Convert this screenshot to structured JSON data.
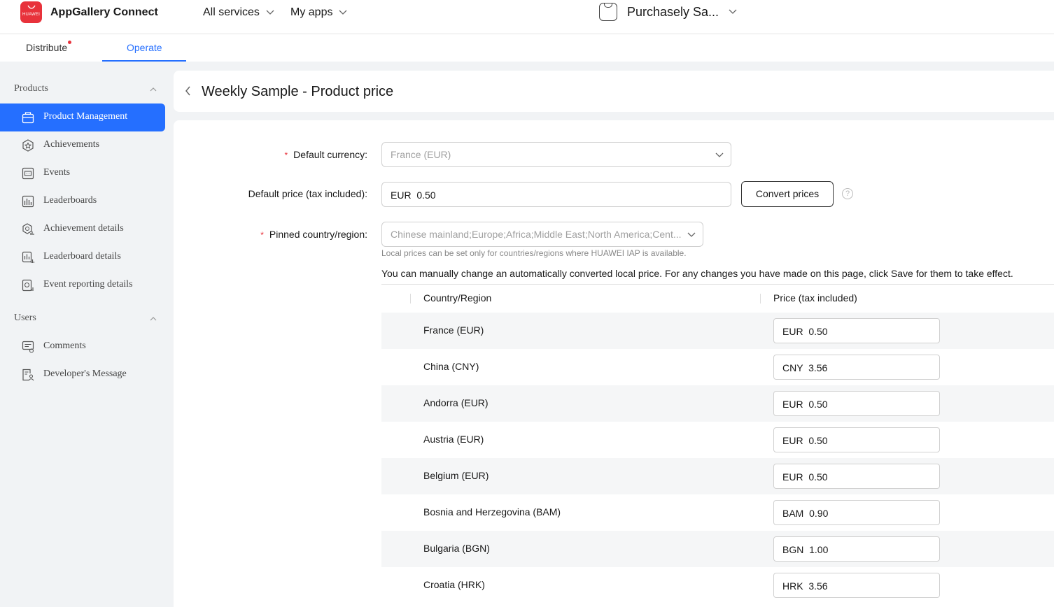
{
  "header": {
    "logo_text": "HUAWEI",
    "app_title": "AppGallery Connect",
    "all_services": "All services",
    "my_apps": "My apps",
    "current_app": "Purchasely Sa..."
  },
  "tabs": {
    "distribute": "Distribute",
    "operate": "Operate"
  },
  "sidebar": {
    "groups": [
      {
        "label": "Products"
      },
      {
        "label": "Users"
      }
    ],
    "items": [
      {
        "label": "Product Management",
        "icon": "bag-icon",
        "active": true
      },
      {
        "label": "Achievements",
        "icon": "achievement-icon"
      },
      {
        "label": "Events",
        "icon": "events-icon"
      },
      {
        "label": "Leaderboards",
        "icon": "leaderboard-icon"
      },
      {
        "label": "Achievement details",
        "icon": "achievement-details-icon"
      },
      {
        "label": "Leaderboard details",
        "icon": "leaderboard-details-icon"
      },
      {
        "label": "Event reporting details",
        "icon": "event-reporting-icon"
      },
      {
        "label": "Comments",
        "icon": "comments-icon"
      },
      {
        "label": "Developer's Message",
        "icon": "developer-message-icon"
      }
    ]
  },
  "page": {
    "title": "Weekly Sample - Product price"
  },
  "form": {
    "default_currency_label": "Default currency:",
    "default_currency_value": "France (EUR)",
    "default_price_label": "Default price (tax included):",
    "default_price_value": "EUR  0.50",
    "convert_button": "Convert prices",
    "help": "?",
    "pinned_label": "Pinned country/region:",
    "pinned_value": "Chinese mainland;Europe;Africa;Middle East;North America;Cent...",
    "hint": "Local prices can be set only for countries/regions where HUAWEI IAP is available.",
    "note": "You can manually change an automatically converted local price. For any changes you have made on this page, click Save for them to take effect."
  },
  "table": {
    "headers": {
      "country": "Country/Region",
      "price": "Price (tax included)"
    },
    "rows": [
      {
        "country": "France (EUR)",
        "price": "EUR  0.50"
      },
      {
        "country": "China (CNY)",
        "price": "CNY  3.56"
      },
      {
        "country": "Andorra (EUR)",
        "price": "EUR  0.50"
      },
      {
        "country": "Austria (EUR)",
        "price": "EUR  0.50"
      },
      {
        "country": "Belgium (EUR)",
        "price": "EUR  0.50"
      },
      {
        "country": "Bosnia and Herzegovina (BAM)",
        "price": "BAM  0.90"
      },
      {
        "country": "Bulgaria (BGN)",
        "price": "BGN  1.00"
      },
      {
        "country": "Croatia (HRK)",
        "price": "HRK  3.56"
      }
    ]
  },
  "colors": {
    "accent": "#256fff",
    "brand": "#e8323b"
  }
}
